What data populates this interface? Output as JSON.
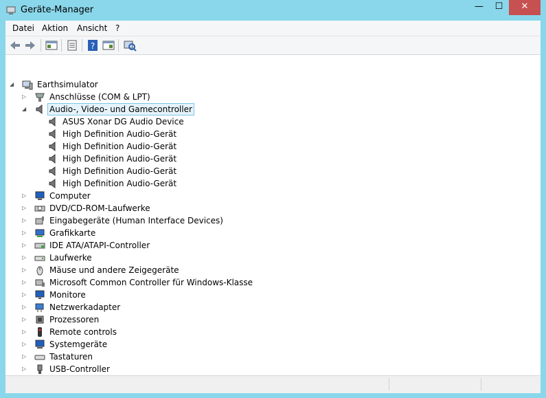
{
  "window": {
    "title": "Geräte-Manager",
    "minimize": "—",
    "maximize": "☐",
    "close": "✕"
  },
  "menu": [
    "Datei",
    "Aktion",
    "Ansicht",
    "?"
  ],
  "toolbar": [
    "back-icon",
    "forward-icon",
    "console-tree-icon",
    "properties-icon",
    "help-icon",
    "action-pane-icon",
    "scan-hardware-icon"
  ],
  "tree": {
    "root": "Earthsimulator",
    "categories": [
      {
        "label": "Anschlüsse (COM & LPT)",
        "icon": "port-icon",
        "expanded": false
      },
      {
        "label": "Audio-, Video- und Gamecontroller",
        "icon": "speaker-icon",
        "expanded": true,
        "selected": true,
        "children": [
          "ASUS Xonar DG Audio Device",
          "High Definition Audio-Gerät",
          "High Definition Audio-Gerät",
          "High Definition Audio-Gerät",
          "High Definition Audio-Gerät",
          "High Definition Audio-Gerät"
        ]
      },
      {
        "label": "Computer",
        "icon": "computer-icon",
        "expanded": false
      },
      {
        "label": "DVD/CD-ROM-Laufwerke",
        "icon": "dvd-icon",
        "expanded": false
      },
      {
        "label": "Eingabegeräte (Human Interface Devices)",
        "icon": "hid-icon",
        "expanded": false
      },
      {
        "label": "Grafikkarte",
        "icon": "display-adapter-icon",
        "expanded": false
      },
      {
        "label": "IDE ATA/ATAPI-Controller",
        "icon": "ide-controller-icon",
        "expanded": false
      },
      {
        "label": "Laufwerke",
        "icon": "disk-drive-icon",
        "expanded": false
      },
      {
        "label": "Mäuse und andere Zeigegeräte",
        "icon": "mouse-icon",
        "expanded": false
      },
      {
        "label": "Microsoft Common Controller für Windows-Klasse",
        "icon": "controller-icon",
        "expanded": false
      },
      {
        "label": "Monitore",
        "icon": "monitor-icon",
        "expanded": false
      },
      {
        "label": "Netzwerkadapter",
        "icon": "network-adapter-icon",
        "expanded": false
      },
      {
        "label": "Prozessoren",
        "icon": "processor-icon",
        "expanded": false
      },
      {
        "label": "Remote controls",
        "icon": "remote-control-icon",
        "expanded": false
      },
      {
        "label": "Systemgeräte",
        "icon": "system-devices-icon",
        "expanded": false
      },
      {
        "label": "Tastaturen",
        "icon": "keyboard-icon",
        "expanded": false
      },
      {
        "label": "USB-Controller",
        "icon": "usb-icon",
        "expanded": false
      }
    ]
  }
}
